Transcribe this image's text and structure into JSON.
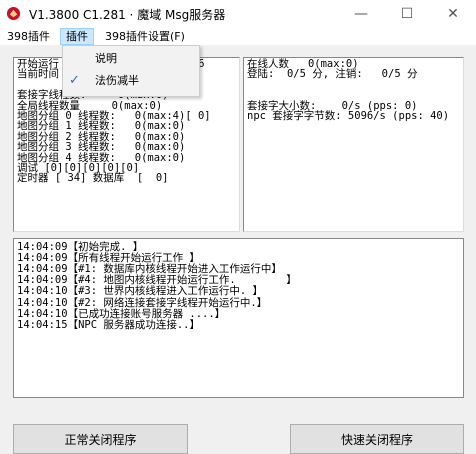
{
  "window": {
    "title": "V1.3800 C1.281 · 魔域 Msg服务器",
    "minimize_glyph": "—",
    "maximize_glyph": "☐",
    "close_glyph": "✕"
  },
  "menubar": {
    "items": [
      "398插件",
      "插件",
      "398插件设置(F)"
    ]
  },
  "dropdown": {
    "items": [
      {
        "label": "说明",
        "checked": false
      },
      {
        "label": "法伤减半",
        "checked": true
      }
    ],
    "check_glyph": "✓"
  },
  "left_panel": {
    "lines": [
      "开始运行                     06",
      "当前时间",
      "",
      "套接字线程数:     0(max:0)",
      "全局线程数量     0(max:0)",
      "地图分组 0 线程数:   0(max:4)[ 0]",
      "地图分组 1 线程数:   0(max:0)",
      "地图分组 2 线程数:   0(max:0)",
      "地图分组 3 线程数:   0(max:0)",
      "地图分组 4 线程数:   0(max:0)",
      "调试 [0][0][0][0][0]",
      "定时器 [ 34] 数据库  [  0]"
    ]
  },
  "right_panel": {
    "lines": [
      "在线人数   0(max:0)",
      "登陆:  0/5 分, 注销:   0/5 分",
      "",
      "",
      "套接字大小数:    0/s (pps: 0)",
      "npc 套接字字节数: 5096/s (pps: 40)"
    ]
  },
  "log": {
    "lines": [
      "14:04:09【初始完成. 】",
      "14:04:09【所有线程开始运行工作 】",
      "14:04:09【#1: 数据库内核线程开始进入工作运行中】",
      "14:04:09【#4: 地图内核线程开始运行工作.        】",
      "14:04:10【#3: 世界内核线程进入工作运行中. 】",
      "14:04:10【#2: 网络连接套接字线程开始运行中.】",
      "14:04:10【已成功连接账号服务器 ....】",
      "14:04:15【NPC 服务器成功连接..】"
    ]
  },
  "buttons": {
    "normal_close": "正常关闭程序",
    "fast_close": "快速关闭程序"
  }
}
